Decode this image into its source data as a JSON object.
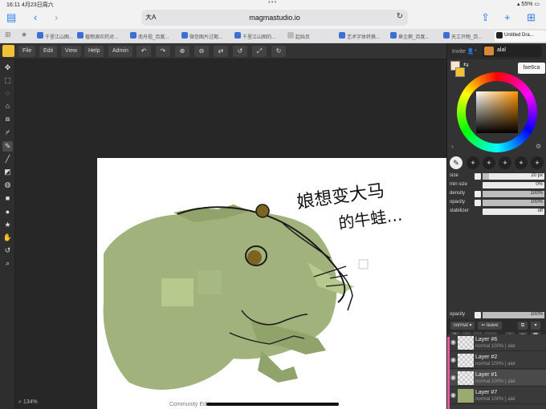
{
  "status_bar": {
    "time": "16:11",
    "date": "4月23日周六",
    "battery": "55%"
  },
  "browser": {
    "text_size_label": "大A",
    "host": "magmastudio.io",
    "tabs": [
      {
        "title": "千里江山图..."
      },
      {
        "title": "植物源农药对..."
      },
      {
        "title": "南舟祖_百度..."
      },
      {
        "title": "微信图片过期..."
      },
      {
        "title": "千里江山图的..."
      },
      {
        "title": "起始页"
      },
      {
        "title": "艺术字体转换..."
      },
      {
        "title": "章企鹅_百度..."
      },
      {
        "title": "天工开物_百..."
      },
      {
        "title": "Untitled Dra..."
      }
    ]
  },
  "menu": {
    "file": "File",
    "edit": "Edit",
    "view": "View",
    "help": "Help",
    "admin": "Admin",
    "actions": [
      "undo-icon",
      "redo-icon",
      "zoom-in-icon",
      "zoom-out-icon",
      "flip-icon",
      "rotate-left-icon",
      "fullscreen-icon",
      "rotate-right-icon"
    ]
  },
  "tools": [
    "move-icon",
    "rect-select-icon",
    "lasso-icon",
    "transform-icon",
    "crop-icon",
    "eyedropper-icon",
    "pencil-icon",
    "brush-icon",
    "eraser-icon",
    "fill-icon",
    "rectangle-icon",
    "ellipse-icon",
    "star-icon",
    "hand-icon",
    "rotate-view-icon",
    "zoom-icon"
  ],
  "zoom": "134%",
  "footer": "Community Edition",
  "canvas_text": {
    "line1": "娘想变大马",
    "line2": "的牛蛙…"
  },
  "right_panel": {
    "invite": "Invite",
    "username": "alal",
    "hex": "fae6ca",
    "primary_color": "#fae6ca",
    "secondary_color": "#f1c232",
    "brush_slots": [
      "1",
      "2",
      "3",
      "4",
      "5",
      "6"
    ],
    "properties": [
      {
        "label": "size",
        "value": "20 px",
        "fill": 0.1
      },
      {
        "label": "min size",
        "value": "0%",
        "fill": 0.0
      },
      {
        "label": "density",
        "value": "100%",
        "fill": 1.0
      },
      {
        "label": "opacity",
        "value": "100%",
        "fill": 1.0
      },
      {
        "label": "stabilizer",
        "value": "off",
        "fill": 0.0
      }
    ],
    "layer_opacity": {
      "label": "opacity",
      "value": "100%"
    },
    "blend_mode": "normal",
    "leave_label": "leave",
    "layers": [
      {
        "name": "Layer #6",
        "meta": "normal 100%  |  alal"
      },
      {
        "name": "Layer #2",
        "meta": "normal 100%  |  alal"
      },
      {
        "name": "Layer #1",
        "meta": "normal 100%  |  alal"
      },
      {
        "name": "Layer #7",
        "meta": "normal 100%  |  alal"
      }
    ]
  }
}
